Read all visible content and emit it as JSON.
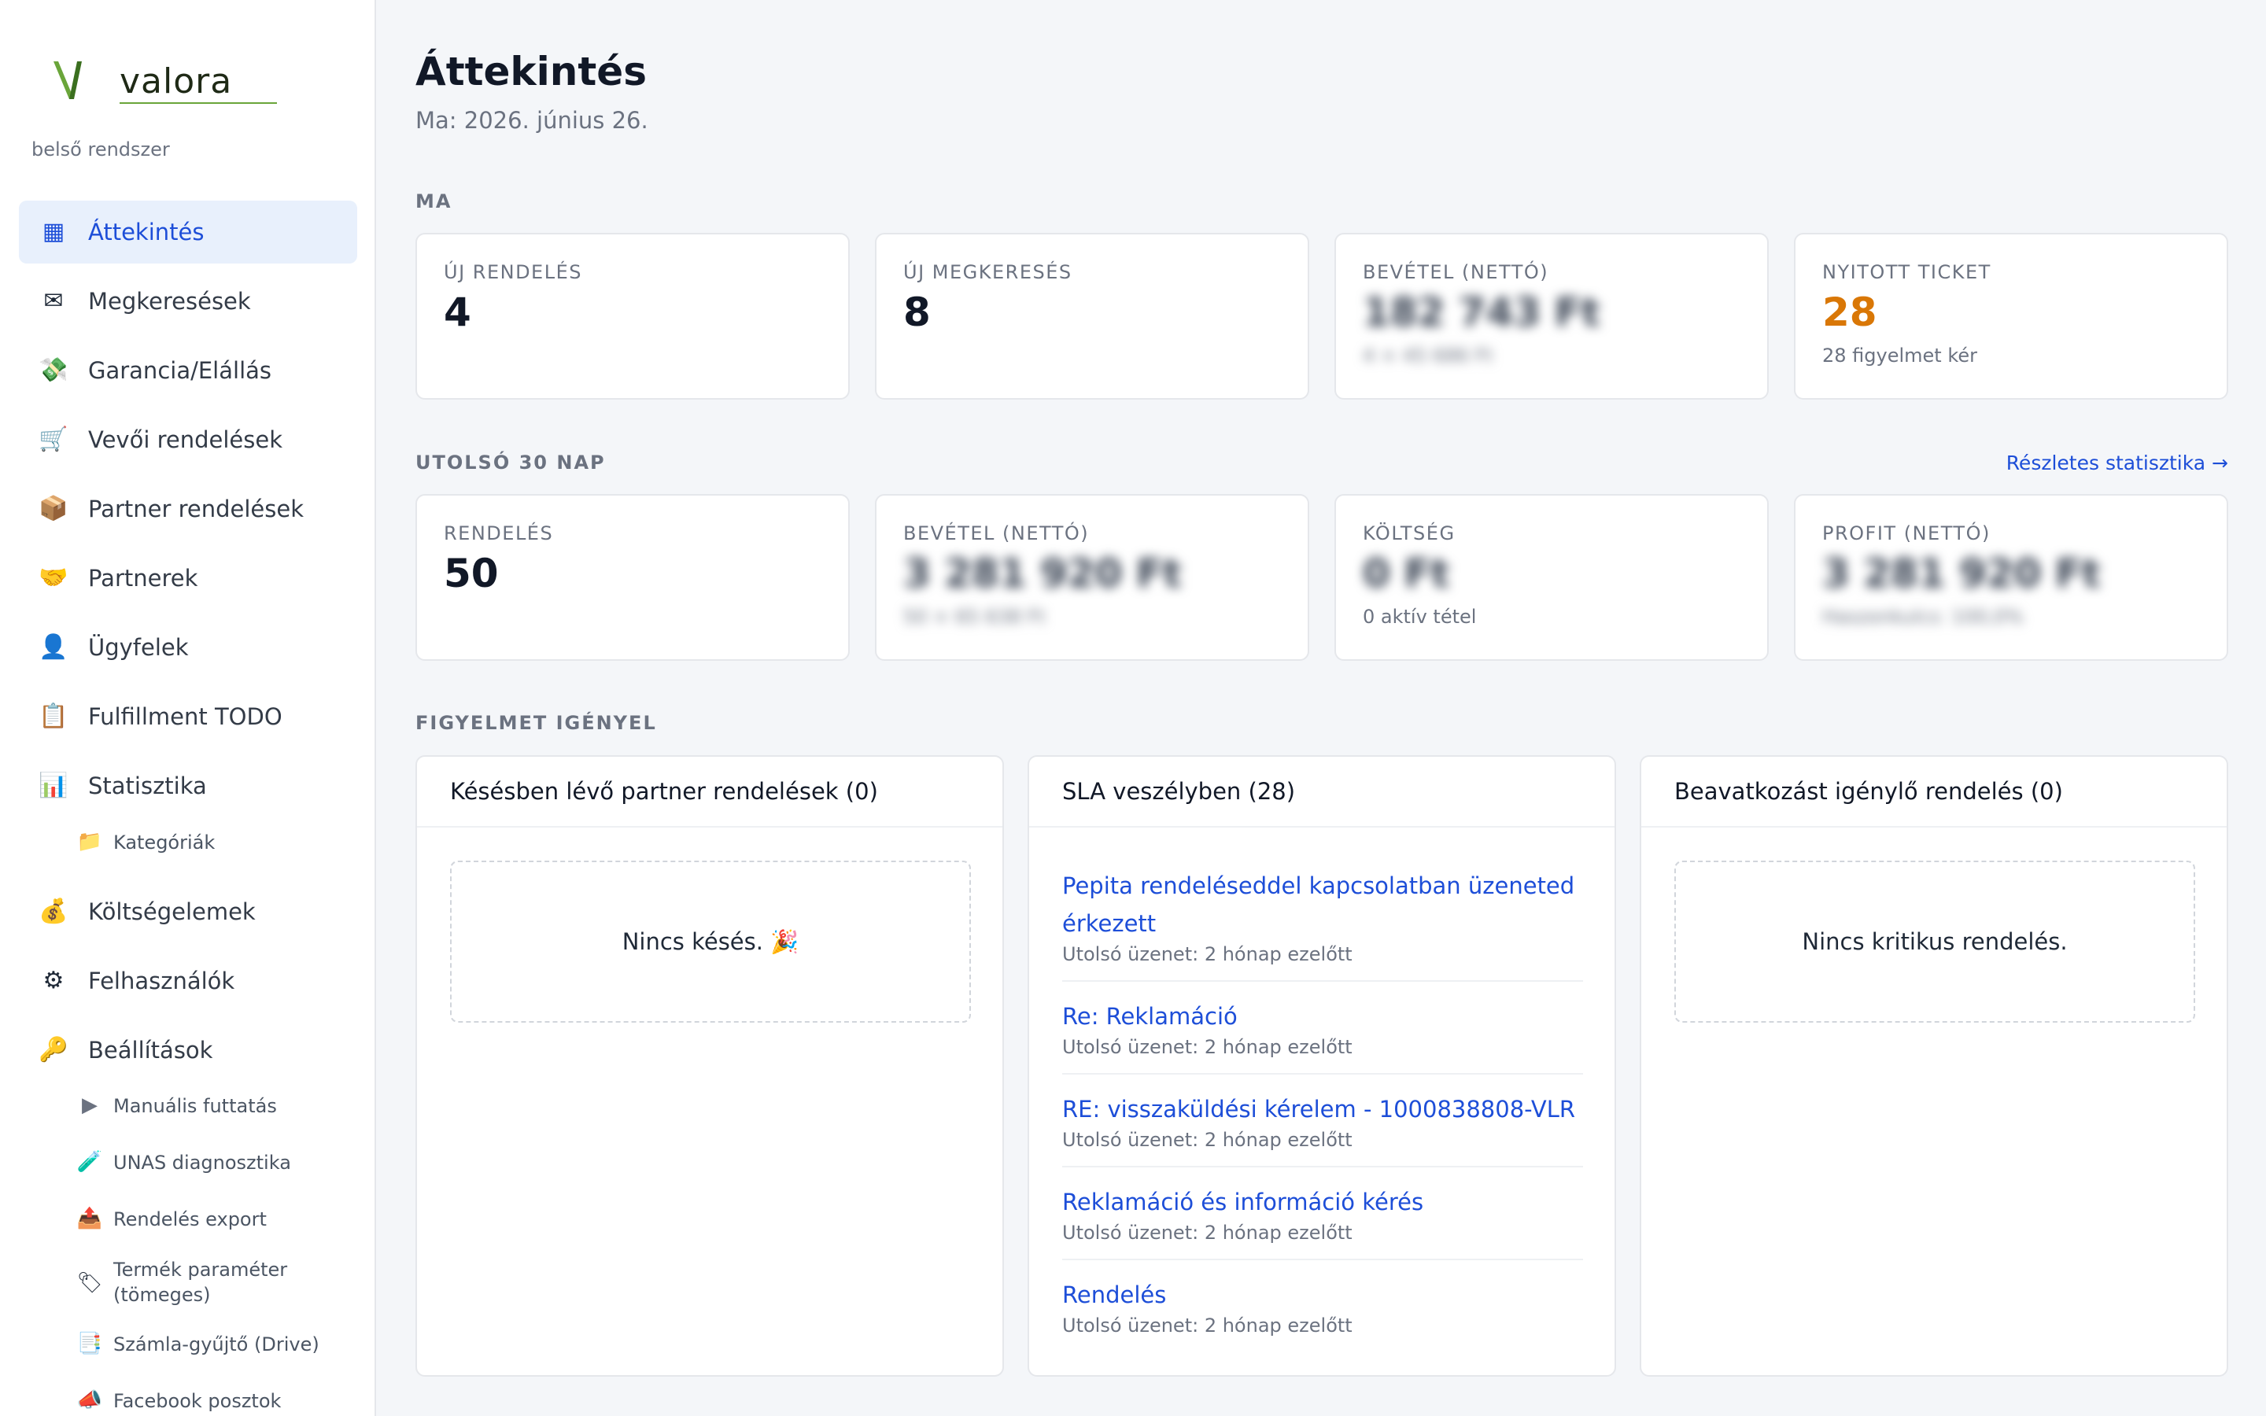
{
  "brand": {
    "name": "valora",
    "subtitle": "belső rendszer",
    "accent": "#6aa53a"
  },
  "sidebar": {
    "items": [
      {
        "icon": "grid-icon",
        "glyph": "▦",
        "label": "Áttekintés",
        "active": true
      },
      {
        "icon": "envelope-icon",
        "glyph": "✉",
        "label": "Megkeresések"
      },
      {
        "icon": "money-icon",
        "glyph": "💸",
        "label": "Garancia/Elállás"
      },
      {
        "icon": "cart-icon",
        "glyph": "🛒",
        "label": "Vevői rendelések"
      },
      {
        "icon": "package-icon",
        "glyph": "📦",
        "label": "Partner rendelések"
      },
      {
        "icon": "handshake-icon",
        "glyph": "🤝",
        "label": "Partnerek"
      },
      {
        "icon": "user-icon",
        "glyph": "👤",
        "label": "Ügyfelek"
      },
      {
        "icon": "clipboard-icon",
        "glyph": "📋",
        "label": "Fulfillment TODO"
      },
      {
        "icon": "chart-icon",
        "glyph": "📊",
        "label": "Statisztika"
      },
      {
        "icon": "moneybag-icon",
        "glyph": "💰",
        "label": "Költségelemek"
      },
      {
        "icon": "gear-icon",
        "glyph": "⚙",
        "label": "Felhasználók"
      },
      {
        "icon": "key-icon",
        "glyph": "🔑",
        "label": "Beállítások"
      }
    ],
    "stat_sub": {
      "icon": "folder-icon",
      "glyph": "📁",
      "label": "Kategóriák"
    },
    "settings_sub": [
      {
        "icon": "play-icon",
        "glyph": "▶",
        "label": "Manuális futtatás"
      },
      {
        "icon": "test-tube-icon",
        "glyph": "🧪",
        "label": "UNAS diagnosztika"
      },
      {
        "icon": "outbox-icon",
        "glyph": "📤",
        "label": "Rendelés export"
      },
      {
        "icon": "tag-icon",
        "glyph": "🏷",
        "label": "Termék paraméter (tömeges)"
      },
      {
        "icon": "document-icon",
        "glyph": "📑",
        "label": "Számla-gyűjtő (Drive)"
      },
      {
        "icon": "megaphone-icon",
        "glyph": "📣",
        "label": "Facebook posztok"
      }
    ]
  },
  "header": {
    "title": "Áttekintés",
    "date": "Ma: 2026. június 26."
  },
  "today": {
    "label": "MA",
    "cards": [
      {
        "label": "ÚJ RENDELÉS",
        "value": "4",
        "sub": ""
      },
      {
        "label": "ÚJ MEGKERESÉS",
        "value": "8",
        "sub": ""
      },
      {
        "label": "BEVÉTEL (NETTÓ)",
        "value": "182 743 Ft",
        "sub": "4 × 45 686 Ft",
        "blurred": true
      },
      {
        "label": "NYITOTT TICKET",
        "value": "28",
        "sub": "28 figyelmet kér",
        "value_color": "#d97706"
      }
    ]
  },
  "last30": {
    "label": "UTOLSÓ 30 NAP",
    "link": "Részletes statisztika →",
    "cards": [
      {
        "label": "RENDELÉS",
        "value": "50",
        "sub": ""
      },
      {
        "label": "BEVÉTEL (NETTÓ)",
        "value": "3 281 920 Ft",
        "sub": "50 × 65 638 Ft",
        "blurred": true
      },
      {
        "label": "KÖLTSÉG",
        "value": "0 Ft",
        "sub": "0 aktív tétel",
        "blurred_value": true
      },
      {
        "label": "PROFIT (NETTÓ)",
        "value": "3 281 920 Ft",
        "sub": "Haszonkulcs: 100,0%",
        "blurred": true
      }
    ]
  },
  "attention": {
    "label": "FIGYELMET IGÉNYEL",
    "panels": [
      {
        "title": "Késésben lévő partner rendelések (0)",
        "empty": "Nincs késés. 🎉"
      },
      {
        "title": "SLA veszélyben (28)"
      },
      {
        "title": "Beavatkozást igénylő rendelés (0)",
        "empty": "Nincs kritikus rendelés."
      }
    ],
    "sla_items": [
      {
        "title": "Pepita rendeléseddel kapcsolatban üzeneted érkezett",
        "sub": "Utolsó üzenet: 2 hónap ezelőtt"
      },
      {
        "title": "Re: Reklamáció",
        "sub": "Utolsó üzenet: 2 hónap ezelőtt"
      },
      {
        "title": "RE: visszaküldési kérelem - 1000838808-VLR",
        "sub": "Utolsó üzenet: 2 hónap ezelőtt"
      },
      {
        "title": "Reklamáció és információ kérés",
        "sub": "Utolsó üzenet: 2 hónap ezelőtt"
      },
      {
        "title": "Rendelés",
        "sub": "Utolsó üzenet: 2 hónap ezelőtt"
      }
    ]
  },
  "colors": {
    "link": "#1d4ed8",
    "active_bg": "#e8f0fc",
    "warning": "#d97706"
  }
}
